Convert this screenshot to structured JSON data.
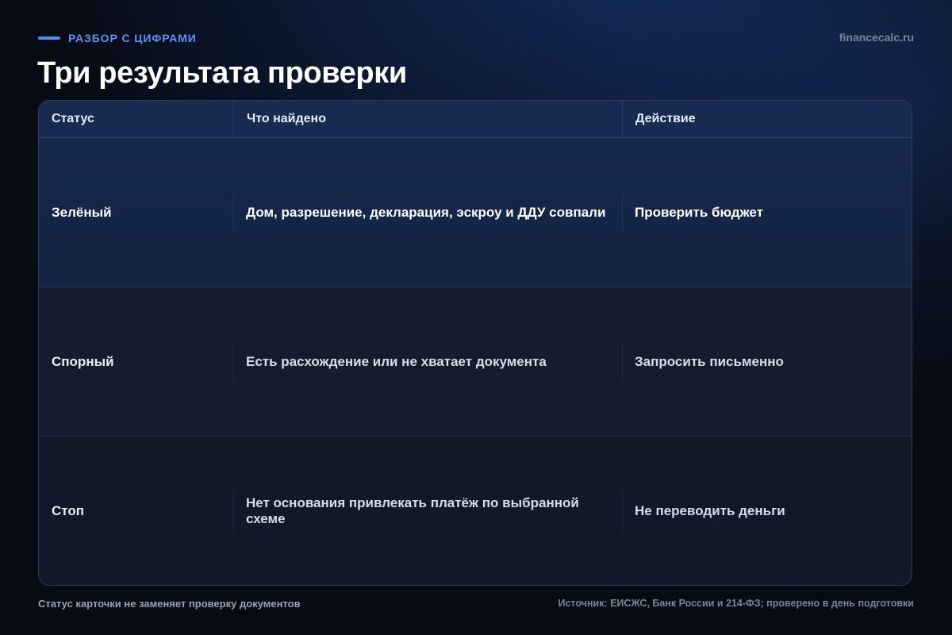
{
  "header": {
    "kicker": "РАЗБОР С ЦИФРАМИ",
    "site": "financecalc.ru",
    "title": "Три результата проверки"
  },
  "table": {
    "columns": [
      "Статус",
      "Что найдено",
      "Действие"
    ],
    "rows": [
      {
        "status": "Зелёный",
        "found": "Дом, разрешение, декларация, эскроу и ДДУ совпали",
        "action": "Проверить бюджет"
      },
      {
        "status": "Спорный",
        "found": "Есть расхождение или не хватает документа",
        "action": "Запросить письменно"
      },
      {
        "status": "Стоп",
        "found": "Нет основания привлекать платёж по выбранной схеме",
        "action": "Не переводить деньги"
      }
    ]
  },
  "footer": {
    "note": "Статус карточки не заменяет проверку документов",
    "source": "Источник: ЕИСЖС, Банк России и 214-ФЗ; проверено в день подготовки"
  },
  "colors": {
    "accent": "#4f8bf3",
    "background": "#070b14",
    "header_row": "#172a50",
    "green_row": "#16284b"
  }
}
